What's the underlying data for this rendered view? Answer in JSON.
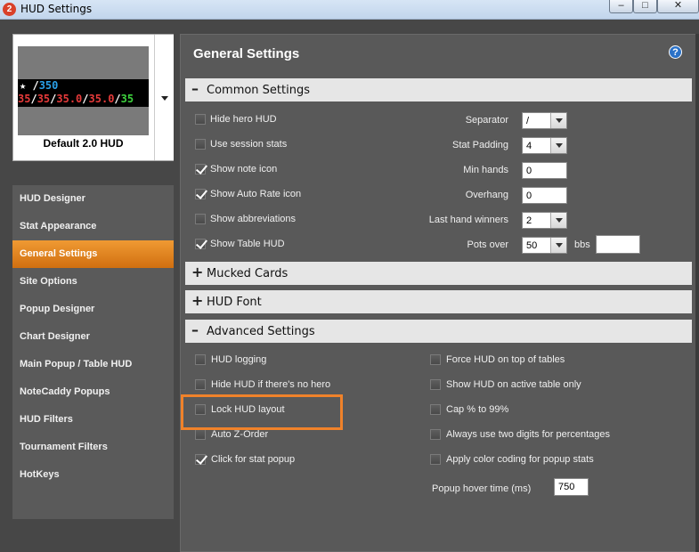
{
  "window": {
    "title": "HUD Settings",
    "app_icon": "2",
    "controls": {
      "minimize": "–",
      "maximize": "□",
      "close": "✕"
    }
  },
  "profile": {
    "name": "Default 2.0 HUD",
    "preview_line1": {
      "icon": "★",
      "sep": " /",
      "value": "350"
    },
    "preview_line2": [
      "35",
      "/",
      "35",
      "/",
      "35.0",
      "/",
      "35.0",
      "/",
      "35"
    ]
  },
  "nav": {
    "active": "General Settings",
    "items": [
      "HUD Designer",
      "Stat Appearance",
      "General Settings",
      "Site Options",
      "Popup Designer",
      "Chart Designer",
      "Main Popup / Table HUD",
      "NoteCaddy Popups",
      "HUD Filters",
      "Tournament Filters",
      "HotKeys"
    ]
  },
  "panel": {
    "title": "General Settings",
    "help": "?"
  },
  "common": {
    "header": "Common Settings",
    "toggle": "–",
    "options": [
      {
        "label": "Hide hero HUD",
        "checked": false
      },
      {
        "label": "Use session stats",
        "checked": false
      },
      {
        "label": "Show note icon",
        "checked": true
      },
      {
        "label": "Show Auto Rate icon",
        "checked": true
      },
      {
        "label": "Show abbreviations",
        "checked": false
      },
      {
        "label": "Show Table HUD",
        "checked": true
      }
    ],
    "separator": {
      "label": "Separator",
      "value": "/"
    },
    "stat_padding": {
      "label": "Stat Padding",
      "value": "4"
    },
    "min_hands": {
      "label": "Min hands",
      "value": "0"
    },
    "overhang": {
      "label": "Overhang",
      "value": "0"
    },
    "last_hand_winners": {
      "label": "Last hand winners",
      "value": "2"
    },
    "pots_over": {
      "label": "Pots over",
      "value": "50",
      "unit": "bbs",
      "extra": ""
    }
  },
  "mucked": {
    "header": "Mucked Cards",
    "toggle": "+"
  },
  "hud_font": {
    "header": "HUD Font",
    "toggle": "+"
  },
  "advanced": {
    "header": "Advanced Settings",
    "toggle": "–",
    "left": [
      {
        "label": "HUD logging",
        "checked": false
      },
      {
        "label": "Hide HUD if there's no hero",
        "checked": false
      },
      {
        "label": "Lock HUD layout",
        "checked": false
      },
      {
        "label": "Auto Z-Order",
        "checked": false
      },
      {
        "label": "Click for stat popup",
        "checked": true
      }
    ],
    "right": [
      {
        "label": "Force HUD on top of tables",
        "checked": false
      },
      {
        "label": "Show HUD on active table only",
        "checked": false
      },
      {
        "label": "Cap % to 99%",
        "checked": false
      },
      {
        "label": "Always use two digits for percentages",
        "checked": false
      },
      {
        "label": "Apply color coding for popup stats",
        "checked": false
      }
    ],
    "popup_hover": {
      "label": "Popup hover time (ms)",
      "value": "750"
    }
  },
  "colors": {
    "accent": "#f0822a",
    "nav_active": "#e07f1e",
    "panel_bg": "#595959",
    "section_bg": "#e6e6e6"
  }
}
